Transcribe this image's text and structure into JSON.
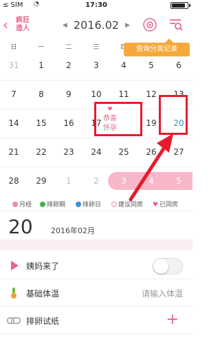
{
  "status_bar": {
    "carrier": "≤ SIM",
    "time": "17:30"
  },
  "header": {
    "logo": [
      "疯狂",
      "造人"
    ],
    "month_label": "2016.02",
    "prev_icon": "triangle-left-icon",
    "next_icon": "triangle-right-icon",
    "record_button_icon": "target-icon",
    "search_records_button_icon": "search-list-icon",
    "tip": "查询分类记录"
  },
  "weekdays": [
    "日",
    "一",
    "二",
    "三",
    "四",
    "五",
    "六"
  ],
  "calendar": {
    "rows": [
      [
        "31",
        "1",
        "2",
        "3",
        "4",
        "5",
        "6"
      ],
      [
        "7",
        "8",
        "9",
        "10",
        "11",
        "12",
        "13"
      ],
      [
        "14",
        "15",
        "16",
        "17",
        "",
        "19",
        "20"
      ],
      [
        "21",
        "22",
        "23",
        "24",
        "25",
        "26",
        "27"
      ],
      [
        "28",
        "29",
        "1",
        "2",
        "3",
        "4",
        "5"
      ]
    ],
    "congrats_text": [
      "恭喜",
      "怀孕"
    ],
    "selected_day": "20"
  },
  "legend": [
    {
      "label": "月经",
      "color": "#f08aa7"
    },
    {
      "label": "排卵期",
      "color": "#3fb54a"
    },
    {
      "label": "排卵日",
      "color": "#3a8fd6"
    },
    {
      "label": "建议同房",
      "color": "#f08aa7"
    },
    {
      "label": "已同房",
      "color": "#e8648a"
    }
  ],
  "date_info": {
    "day": "20",
    "month": "2016年02月"
  },
  "items": [
    {
      "label": "姨妈来了",
      "icon": "drop-play-icon",
      "toggle_on": false
    },
    {
      "label": "基础体温",
      "icon": "thermometer-icon",
      "placeholder": "请输入体温"
    },
    {
      "label": "排卵试纸",
      "icon": "test-strip-icon",
      "action": "+"
    }
  ],
  "colors": {
    "brand_pink": "#e8648a",
    "tip_orange": "#f6a93b",
    "highlight_red": "#e8192c"
  }
}
